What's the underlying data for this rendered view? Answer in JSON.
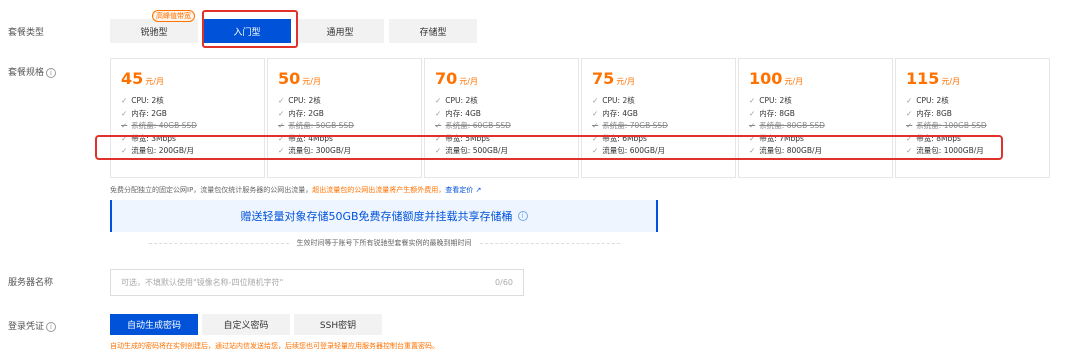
{
  "labels": {
    "plan_type": "套餐类型",
    "plan_spec": "套餐规格",
    "server_name": "服务器名称",
    "credential": "登录凭证"
  },
  "info_icon": "i",
  "type_badge": "高峰值带宽",
  "plan_types": [
    "锐驰型",
    "入门型",
    "通用型",
    "存储型"
  ],
  "plans": [
    {
      "price": "45",
      "unit": "元/月",
      "specs": [
        "CPU: 2核",
        "内存: 2GB",
        "系统盘: 40GB SSD",
        "带宽: 3Mbps",
        "流量包: 200GB/月"
      ]
    },
    {
      "price": "50",
      "unit": "元/月",
      "specs": [
        "CPU: 2核",
        "内存: 2GB",
        "系统盘: 50GB SSD",
        "带宽: 4Mbps",
        "流量包: 300GB/月"
      ]
    },
    {
      "price": "70",
      "unit": "元/月",
      "specs": [
        "CPU: 2核",
        "内存: 4GB",
        "系统盘: 60GB SSD",
        "带宽: 5Mbps",
        "流量包: 500GB/月"
      ]
    },
    {
      "price": "75",
      "unit": "元/月",
      "specs": [
        "CPU: 2核",
        "内存: 4GB",
        "系统盘: 70GB SSD",
        "带宽: 6Mbps",
        "流量包: 600GB/月"
      ]
    },
    {
      "price": "100",
      "unit": "元/月",
      "specs": [
        "CPU: 2核",
        "内存: 8GB",
        "系统盘: 80GB SSD",
        "带宽: 7Mbps",
        "流量包: 800GB/月"
      ]
    },
    {
      "price": "115",
      "unit": "元/月",
      "specs": [
        "CPU: 2核",
        "内存: 8GB",
        "系统盘: 100GB SSD",
        "带宽: 8Mbps",
        "流量包: 1000GB/月"
      ]
    }
  ],
  "check_glyph": "✓",
  "ip_note": {
    "text": "免费分配独立的固定公网IP，流量包仅统计服务器的公网出流量，",
    "warn": "超出流量包的公网出流量将产生额外费用，",
    "link": "查看定价"
  },
  "gift": {
    "title": "赠送轻量对象存储50GB免费存储额度并挂载共享存储桶",
    "subtitle": "生效时间等于账号下所有锐驰型套餐实例的最晚到期时间"
  },
  "server_name": {
    "placeholder": "可选，不填默认使用\"镜像名称-四位随机字符\"",
    "counter": "0/60"
  },
  "credential_tabs": [
    "自动生成密码",
    "自定义密码",
    "SSH密钥"
  ],
  "credential_note": "自动生成的密码将在实例创建后，通过站内信发送给您，后续您也可登录轻量应用服务器控制台重置密码。"
}
